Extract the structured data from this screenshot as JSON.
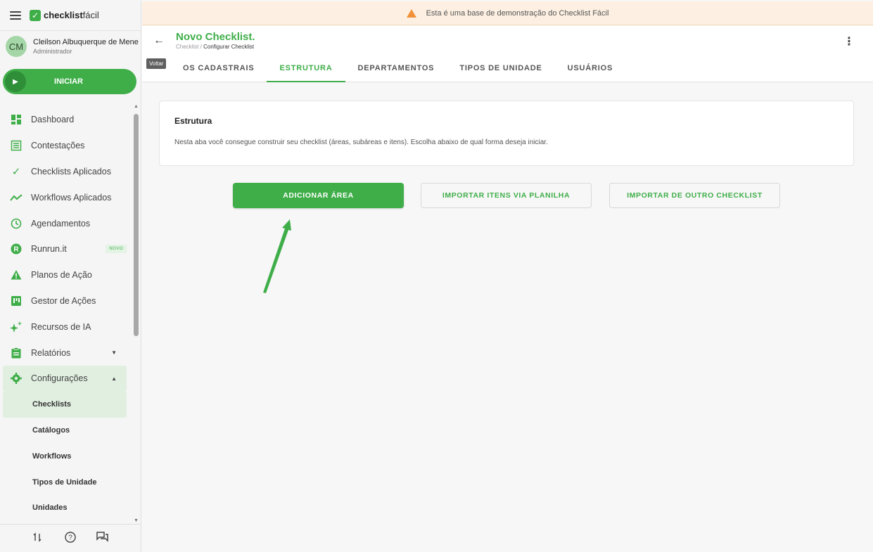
{
  "sidebar": {
    "logo_bold": "checklist",
    "logo_regular": "fácil",
    "user": {
      "initials": "CM",
      "name": "Cleilson Albuquerque de Mene",
      "role": "Administrador"
    },
    "start_label": "INICIAR",
    "menu": [
      {
        "label": "Dashboard",
        "icon": "dashboard-icon"
      },
      {
        "label": "Contestações",
        "icon": "list-icon"
      },
      {
        "label": "Checklists Aplicados",
        "icon": "check-icon"
      },
      {
        "label": "Workflows Aplicados",
        "icon": "trend-icon"
      },
      {
        "label": "Agendamentos",
        "icon": "clock-icon"
      },
      {
        "label": "Runrun.it",
        "icon": "runrunit-icon",
        "badge": "NOVO"
      },
      {
        "label": "Planos de Ação",
        "icon": "warning-icon"
      },
      {
        "label": "Gestor de Ações",
        "icon": "kanban-icon"
      },
      {
        "label": "Recursos de IA",
        "icon": "sparkle-icon"
      },
      {
        "label": "Relatórios",
        "icon": "report-icon"
      },
      {
        "label": "Configurações",
        "icon": "gear-icon"
      }
    ],
    "submenu": [
      {
        "label": "Checklists"
      },
      {
        "label": "Catálogos"
      },
      {
        "label": "Workflows"
      },
      {
        "label": "Tipos de Unidade"
      },
      {
        "label": "Unidades"
      }
    ]
  },
  "banner": {
    "text": "Esta é uma base de demonstração do Checklist Fácil"
  },
  "header": {
    "title": "Novo Checklist.",
    "breadcrumb_parent": "Checklist",
    "breadcrumb_sep": " / ",
    "breadcrumb_current": "Configurar Checklist",
    "tooltip": "Voltar",
    "tabs": [
      {
        "label": "OS CADASTRAIS"
      },
      {
        "label": "ESTRUTURA"
      },
      {
        "label": "DEPARTAMENTOS"
      },
      {
        "label": "TIPOS DE UNIDADE"
      },
      {
        "label": "USUÁRIOS"
      }
    ]
  },
  "card": {
    "title": "Estrutura",
    "text": "Nesta aba você consegue construir seu checklist (áreas, subáreas e itens). Escolha abaixo de qual forma deseja iniciar."
  },
  "actions": {
    "add_area": "ADICIONAR ÁREA",
    "import_sheet": "IMPORTAR ITENS VIA PLANILHA",
    "import_other": "IMPORTAR DE OUTRO CHECKLIST"
  },
  "colors": {
    "accent": "#3fae49",
    "banner_bg": "#fdf0e2",
    "warning": "#f0913a"
  }
}
